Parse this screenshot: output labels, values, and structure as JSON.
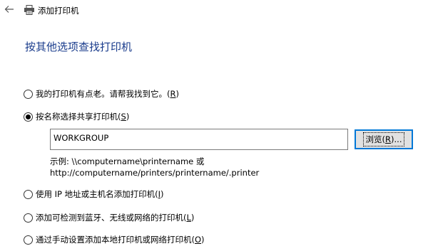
{
  "window": {
    "title": "添加打印机",
    "back_icon": "back-arrow-icon",
    "app_icon": "printer-icon"
  },
  "heading": "按其他选项查找打印机",
  "options": [
    {
      "label": "我的打印机有点老。请帮我找到它。(",
      "key": "R",
      "suffix": ")",
      "selected": false
    },
    {
      "label": "按名称选择共享打印机(",
      "key": "S",
      "suffix": ")",
      "selected": true
    },
    {
      "label": "使用 IP 地址或主机名添加打印机(",
      "key": "I",
      "suffix": ")",
      "selected": false
    },
    {
      "label": "添加可检测到蓝牙、无线或网络的打印机(",
      "key": "L",
      "suffix": ")",
      "selected": false
    },
    {
      "label": "通过手动设置添加本地打印机或网络打印机(",
      "key": "O",
      "suffix": ")",
      "selected": false
    }
  ],
  "shared_printer": {
    "value": "WORKGROUP",
    "browse": {
      "prefix": "浏览(",
      "key": "R",
      "suffix": ")..."
    },
    "example_line1": "示例: \\\\computername\\printername 或",
    "example_line2": "http://computername/printers/printername/.printer"
  },
  "colors": {
    "heading": "#1a3c8c",
    "focus_border": "#0078d7",
    "button_bg": "#e1e1e1"
  }
}
